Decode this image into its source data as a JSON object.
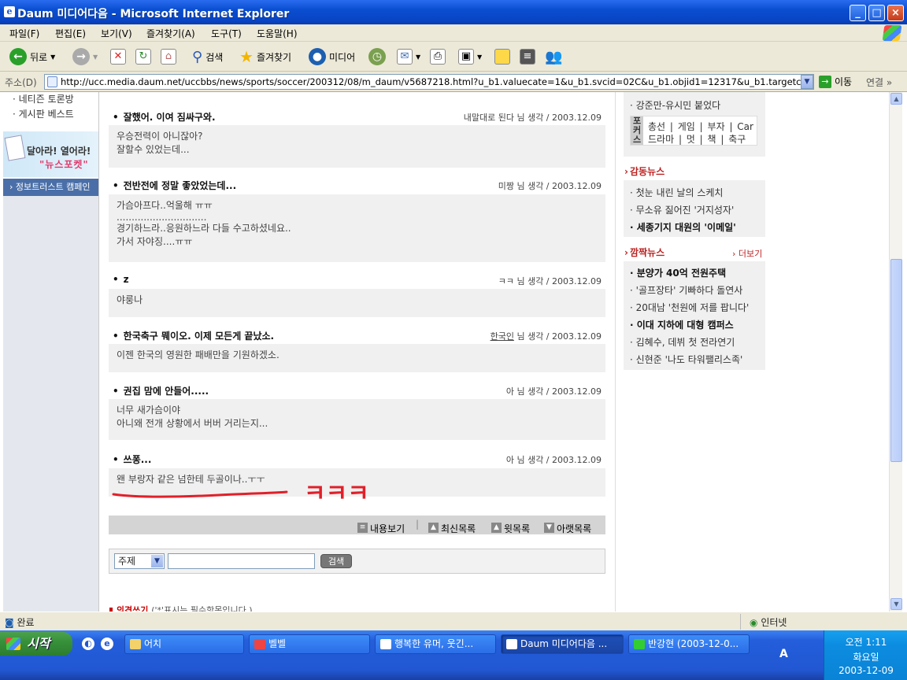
{
  "window": {
    "title": "Daum 미디어다음 - Microsoft Internet Explorer",
    "min": "_",
    "max": "□",
    "close": "×"
  },
  "menu": [
    "파일(F)",
    "편집(E)",
    "보기(V)",
    "즐겨찾기(A)",
    "도구(T)",
    "도움말(H)"
  ],
  "toolbar": {
    "back": "뒤로",
    "search": "검색",
    "favorites": "즐겨찾기",
    "media": "미디어"
  },
  "address": {
    "label": "주소(D)",
    "url": "http://ucc.media.daum.net/uccbbs/news/sports/soccer/200312/08/m_daum/v5687218.html?u_b1.valuecate=1&u_b1.svcid=02C&u_b1.objid1=12317&u_b1.targetcate=18",
    "go": "이동",
    "links": "연결"
  },
  "leftnav": {
    "items": [
      "네티즌 토론방",
      "게시판 베스트"
    ],
    "banner_line1": "달아라! 열어라!",
    "banner_line2": "\"뉴스포켓\"",
    "campaign": "정보트러스트 캠페인"
  },
  "comments": [
    {
      "title": "잘했어. 이여 짐싸구와.",
      "author": "내말대로 된다",
      "meta": "님 생각 / 2003.12.09",
      "lines": [
        "우승전력이 아니잖아?",
        "잘할수 있었는데..."
      ]
    },
    {
      "title": "전반전에 정말 좋았었는데...",
      "author": "미짱",
      "meta": "님 생각 / 2003.12.09",
      "lines": [
        "가슴아프다..억울해 ㅠㅠ",
        "..............................",
        "경기하느라..응원하느라 다들 수고하셨네요..",
        "가서 자야징....ㅠㅠ"
      ]
    },
    {
      "title": "z",
      "author": "ㅋㅋ",
      "meta": "님 생각 / 2003.12.09",
      "lines": [
        "야룽나"
      ]
    },
    {
      "title": "한국축구 뭬이오. 이제 모든게 끝났소.",
      "author": "한국인",
      "meta": "님 생각 / 2003.12.09",
      "lines": [
        "이젠 한국의 영원한 패배만을 기원하겠소."
      ]
    },
    {
      "title": "권집 맘에 안들어.....",
      "author": "아",
      "meta": "님 생각 / 2003.12.09",
      "lines": [
        "너무 새가슴이야",
        "아니왜 전개 상황에서 버버 거리는지..."
      ]
    },
    {
      "title": "쓰퐁...",
      "author": "아",
      "meta": "님 생각 / 2003.12.09",
      "lines": [
        "왠 부랑자 같은 넘한테 두골이나..ㅜㅜ"
      ]
    }
  ],
  "annotation": "ㅋㅋㅋ",
  "listnav": {
    "view": "내용보기",
    "latest": "최신목록",
    "prev": "윗목록",
    "next": "아랫목록"
  },
  "search": {
    "option": "주제",
    "button": "검색"
  },
  "opinion": {
    "label": "의견쓰기",
    "note": "('*'표시는 필수항목입니다.)"
  },
  "right": {
    "top_item": "강준만-유시민 붙었다",
    "focus_tag": "포커스",
    "focus_row1": [
      "총선",
      "게임",
      "부자",
      "Car"
    ],
    "focus_row2": [
      "드라마",
      "멋",
      "책",
      "축구"
    ],
    "emotion_title": "감동뉴스",
    "emotion": [
      "첫눈 내린 날의 스케치",
      "무소유 짊어진 '거지성자'",
      "세종기지 대원의 '이메일'"
    ],
    "surprise_title": "깜짝뉴스",
    "more": "더보기",
    "surprise": [
      "분양가 40억 전원주택",
      "'골프장타' 기빠하다 돌연사",
      "20대남 '천원에 저를 팝니다'",
      "이대 지하에 대형 캠퍼스",
      "김혜수, 데뷔 첫 전라연기",
      "신현준 '나도 타워팰리스족'"
    ]
  },
  "status": {
    "left": "완료",
    "zone": "인터넷"
  },
  "taskbar": {
    "start": "시작",
    "tasks": [
      "어치",
      "벨벨",
      "행복한 유머, 웃긴...",
      "Daum 미디어다음 ...",
      "반강현 (2003-12-0..."
    ],
    "time": "오전 1:11",
    "day": "화요일",
    "date": "2003-12-09"
  }
}
